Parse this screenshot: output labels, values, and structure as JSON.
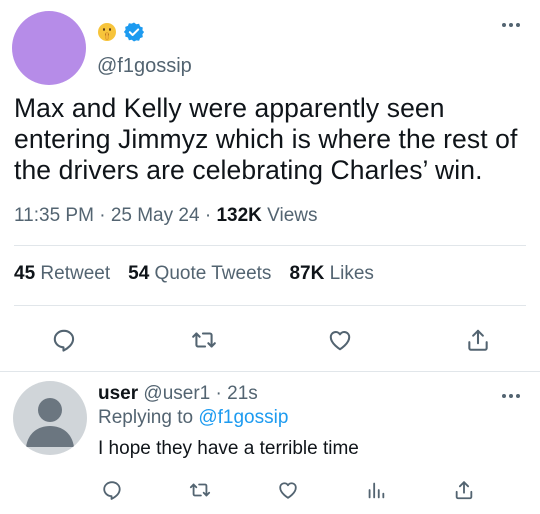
{
  "tweet": {
    "handle": "@f1gossip",
    "text": "Max and Kelly were apparently seen entering Jimmyz which is where the rest of the drivers are celebrating Charles’ win.",
    "time": "11:35 PM",
    "date": "25 May 24",
    "separator": "·",
    "views_count": "132K",
    "views_label": "Views",
    "retweet_count": "45",
    "retweet_label": "Retweet",
    "quote_count": "54",
    "quote_label": "Quote Tweets",
    "likes_count": "87K",
    "likes_label": "Likes",
    "emoji_icon": "shushing-face-emoji",
    "verified_color": "#1d9bf0",
    "avatar_color": "#b68ce8"
  },
  "reply": {
    "name": "user",
    "handle": "@user1",
    "separator": "·",
    "time": "21s",
    "replying_label": "Replying to",
    "replying_to": "@f1gossip",
    "text": "I hope they have a terrible time"
  },
  "colors": {
    "muted": "#536471",
    "link": "#1d9bf0",
    "divider": "#e1e6ea"
  }
}
